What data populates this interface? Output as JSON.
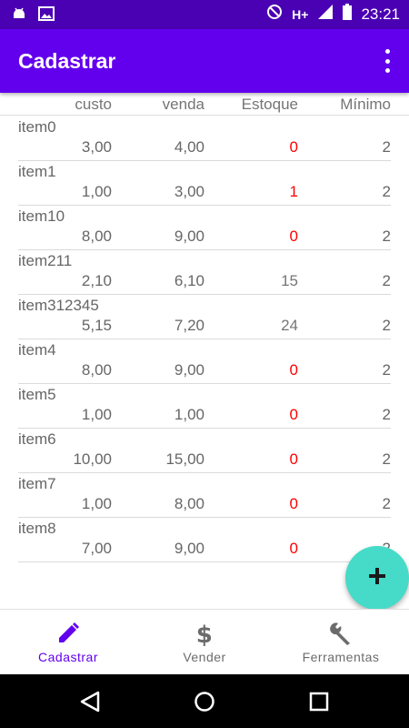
{
  "status_bar": {
    "network": "H+",
    "time": "23:21",
    "icons": [
      "android-debug-icon",
      "image-icon",
      "dnd-icon",
      "signal-icon",
      "battery-icon"
    ]
  },
  "app_bar": {
    "title": "Cadastrar",
    "menu_icon": "overflow-menu-icon"
  },
  "list_header": {
    "custo": "custo",
    "venda": "venda",
    "estoque": "Estoque",
    "minimo": "Mínimo"
  },
  "items": [
    {
      "name": "item0",
      "custo": "3,00",
      "venda": "4,00",
      "estoque": "0",
      "minimo": "2"
    },
    {
      "name": "item1",
      "custo": "1,00",
      "venda": "3,00",
      "estoque": "1",
      "minimo": "2"
    },
    {
      "name": "item10",
      "custo": "8,00",
      "venda": "9,00",
      "estoque": "0",
      "minimo": "2"
    },
    {
      "name": "item211",
      "custo": "2,10",
      "venda": "6,10",
      "estoque": "15",
      "minimo": "2"
    },
    {
      "name": "item312345",
      "custo": "5,15",
      "venda": "7,20",
      "estoque": "24",
      "minimo": "2"
    },
    {
      "name": "item4",
      "custo": "8,00",
      "venda": "9,00",
      "estoque": "0",
      "minimo": "2"
    },
    {
      "name": "item5",
      "custo": "1,00",
      "venda": "1,00",
      "estoque": "0",
      "minimo": "2"
    },
    {
      "name": "item6",
      "custo": "10,00",
      "venda": "15,00",
      "estoque": "0",
      "minimo": "2"
    },
    {
      "name": "item7",
      "custo": "1,00",
      "venda": "8,00",
      "estoque": "0",
      "minimo": "2"
    },
    {
      "name": "item8",
      "custo": "7,00",
      "venda": "9,00",
      "estoque": "0",
      "minimo": "2"
    }
  ],
  "fab": {
    "icon": "plus-icon",
    "color": "#45dbc8"
  },
  "bottom_nav": {
    "cadastrar": {
      "label": "Cadastrar",
      "icon": "pencil-icon"
    },
    "vender": {
      "label": "Vender",
      "icon": "dollar-icon"
    },
    "ferramentas": {
      "label": "Ferramentas",
      "icon": "wrench-icon"
    }
  },
  "colors": {
    "primary": "#6200ee",
    "status_bar": "#4a00b3",
    "low_stock": "#ff0000",
    "accent": "#45dbc8"
  }
}
